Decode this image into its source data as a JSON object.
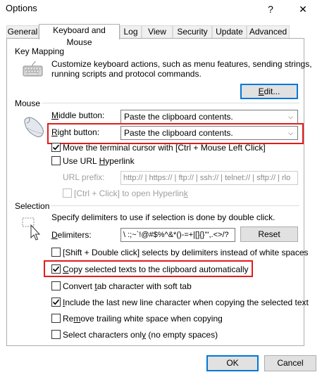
{
  "window": {
    "title": "Options",
    "help": "?",
    "close": "✕"
  },
  "tabs": [
    "General",
    "Keyboard and Mouse",
    "Log",
    "View",
    "Security",
    "Update",
    "Advanced"
  ],
  "key_mapping": {
    "group": "Key Mapping",
    "desc1": "Customize keyboard actions, such as menu features, sending strings,",
    "desc2": "running scripts and protocol commands.",
    "edit_pre": "",
    "edit_u": "E",
    "edit_post": "dit..."
  },
  "mouse": {
    "group": "Mouse",
    "middle_pre": "",
    "middle_u": "M",
    "middle_post": "iddle button:",
    "middle_value": "Paste the clipboard contents.",
    "right_pre": "",
    "right_u": "R",
    "right_post": "ight button:",
    "right_value": "Paste the clipboard contents.",
    "move_cursor": "Move the terminal cursor with [Ctrl + Mouse Left Click]",
    "use_url_pre": "Use URL ",
    "use_url_u": "H",
    "use_url_post": "yperlink",
    "url_prefix": "URL prefix:",
    "url_prefix_value": "http:// | https:// | ftp:// | ssh:// | telnet:// | sftp:// | rlo",
    "ctrl_click": "[Ctrl + Click] to open Hyperlin",
    "ctrl_click_u": "k"
  },
  "selection": {
    "group": "Selection",
    "desc": "Specify delimiters to use if selection is done by double click.",
    "delim_pre": "",
    "delim_u": "D",
    "delim_post": "elimiters:",
    "delim_value": "\\ :;~`!@#$%^&*()-=+|[]{}'\",.<>/?",
    "reset": "Reset",
    "shift_dbl": "[Shift + Double click] selects by delimiters instead of white spaces",
    "copy_pre": "",
    "copy_u": "C",
    "copy_post": "opy selected texts to the clipboard automatically",
    "convert_tab_pre": "Convert ",
    "convert_tab_u": "t",
    "convert_tab_post": "ab character with soft tab",
    "include_pre": "",
    "include_u": "I",
    "include_post": "nclude the last new line character when copying the selected text",
    "remove_pre": "Re",
    "remove_u": "m",
    "remove_post": "ove trailing white space when copying",
    "select_chars_pre": "Select characters onl",
    "select_chars_u": "y",
    "select_chars_post": " (no empty spaces)"
  },
  "footer": {
    "ok": "OK",
    "cancel": "Cancel"
  },
  "checks": {
    "move_cursor": true,
    "use_url": false,
    "ctrl_click": false,
    "shift_dbl": false,
    "copy": true,
    "convert_tab": false,
    "include": true,
    "remove": false,
    "select_chars": false
  },
  "colors": {
    "highlight": "#e21b1b",
    "accent": "#0078d7"
  },
  "icons": [
    "keyboard-icon",
    "mouse-icon",
    "selection-cursor-icon",
    "checkmark-icon",
    "chevron-down-icon",
    "help-icon",
    "close-icon"
  ]
}
